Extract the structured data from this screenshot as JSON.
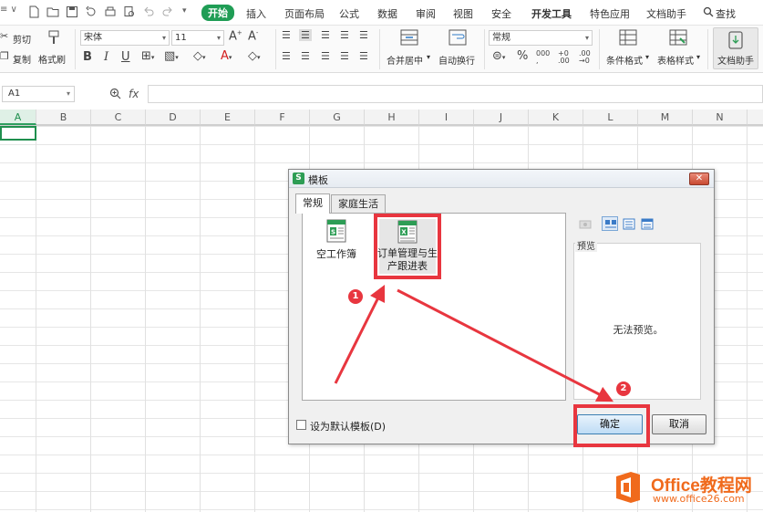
{
  "menubar": {
    "tabs": [
      "开始",
      "插入",
      "页面布局",
      "公式",
      "数据",
      "审阅",
      "视图",
      "安全",
      "开发工具",
      "特色应用",
      "文档助手"
    ],
    "search": "查找"
  },
  "ribbon": {
    "cut": "剪切",
    "copy": "复制",
    "format_painter": "格式刷",
    "font_name": "宋体",
    "font_size": "11",
    "merge_center": "合并居中",
    "wrap_text": "自动换行",
    "number_format": "常规",
    "conditional_format": "条件格式",
    "table_style": "表格样式",
    "doc_assistant": "文档助手"
  },
  "formula_bar": {
    "name_box": "A1",
    "fx": "fx",
    "value": ""
  },
  "grid": {
    "columns": [
      "A",
      "B",
      "C",
      "D",
      "E",
      "F",
      "G",
      "H",
      "I",
      "J",
      "K",
      "L",
      "M",
      "N"
    ],
    "selected_column": "A",
    "selected_cell": "A1"
  },
  "dialog": {
    "title": "模板",
    "tabs": [
      "常规",
      "家庭生活"
    ],
    "active_tab": "常规",
    "templates": [
      {
        "label": "空工作簿"
      },
      {
        "label_line1": "订单管理与生",
        "label_line2": "产跟进表"
      }
    ],
    "preview_label": "预览",
    "no_preview": "无法预览。",
    "default_checkbox": "设为默认模板(D)",
    "default_checked": false,
    "ok": "确定",
    "cancel": "取消"
  },
  "annotations": {
    "step1": "1",
    "step2": "2",
    "color": "#e8363f"
  },
  "watermark": {
    "title": "Office教程网",
    "url": "www.office26.com"
  },
  "colors": {
    "accent_green": "#1f9d55",
    "highlight_red": "#e8363f",
    "watermark_orange": "#f06a1c"
  }
}
